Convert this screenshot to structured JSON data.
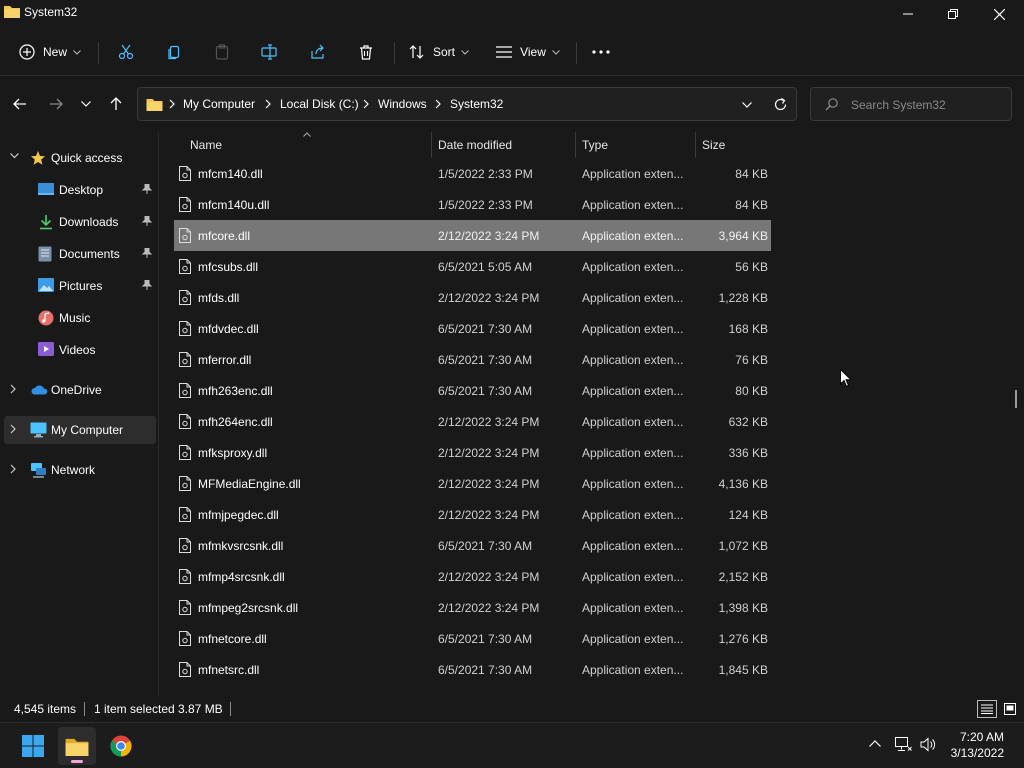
{
  "window": {
    "title": "System32"
  },
  "toolbar": {
    "new_label": "New",
    "sort_label": "Sort",
    "view_label": "View"
  },
  "breadcrumb": [
    "My Computer",
    "Local Disk (C:)",
    "Windows",
    "System32"
  ],
  "search": {
    "placeholder": "Search System32"
  },
  "sidebar": {
    "quick_access": "Quick access",
    "items": [
      {
        "label": "Desktop",
        "icon": "desktop-icon",
        "pinned": true
      },
      {
        "label": "Downloads",
        "icon": "downloads-icon",
        "pinned": true
      },
      {
        "label": "Documents",
        "icon": "documents-icon",
        "pinned": true
      },
      {
        "label": "Pictures",
        "icon": "pictures-icon",
        "pinned": true
      },
      {
        "label": "Music",
        "icon": "music-icon",
        "pinned": false
      },
      {
        "label": "Videos",
        "icon": "videos-icon",
        "pinned": false
      }
    ],
    "onedrive": "OneDrive",
    "my_computer": "My Computer",
    "network": "Network"
  },
  "columns": {
    "name": "Name",
    "date": "Date modified",
    "type": "Type",
    "size": "Size"
  },
  "files": [
    {
      "name": "mfcm140.dll",
      "date": "1/5/2022 2:33 PM",
      "type": "Application exten...",
      "size": "84 KB"
    },
    {
      "name": "mfcm140u.dll",
      "date": "1/5/2022 2:33 PM",
      "type": "Application exten...",
      "size": "84 KB"
    },
    {
      "name": "mfcore.dll",
      "date": "2/12/2022 3:24 PM",
      "type": "Application exten...",
      "size": "3,964 KB"
    },
    {
      "name": "mfcsubs.dll",
      "date": "6/5/2021 5:05 AM",
      "type": "Application exten...",
      "size": "56 KB"
    },
    {
      "name": "mfds.dll",
      "date": "2/12/2022 3:24 PM",
      "type": "Application exten...",
      "size": "1,228 KB"
    },
    {
      "name": "mfdvdec.dll",
      "date": "6/5/2021 7:30 AM",
      "type": "Application exten...",
      "size": "168 KB"
    },
    {
      "name": "mferror.dll",
      "date": "6/5/2021 7:30 AM",
      "type": "Application exten...",
      "size": "76 KB"
    },
    {
      "name": "mfh263enc.dll",
      "date": "6/5/2021 7:30 AM",
      "type": "Application exten...",
      "size": "80 KB"
    },
    {
      "name": "mfh264enc.dll",
      "date": "2/12/2022 3:24 PM",
      "type": "Application exten...",
      "size": "632 KB"
    },
    {
      "name": "mfksproxy.dll",
      "date": "2/12/2022 3:24 PM",
      "type": "Application exten...",
      "size": "336 KB"
    },
    {
      "name": "MFMediaEngine.dll",
      "date": "2/12/2022 3:24 PM",
      "type": "Application exten...",
      "size": "4,136 KB"
    },
    {
      "name": "mfmjpegdec.dll",
      "date": "2/12/2022 3:24 PM",
      "type": "Application exten...",
      "size": "124 KB"
    },
    {
      "name": "mfmkvsrcsnk.dll",
      "date": "6/5/2021 7:30 AM",
      "type": "Application exten...",
      "size": "1,072 KB"
    },
    {
      "name": "mfmp4srcsnk.dll",
      "date": "2/12/2022 3:24 PM",
      "type": "Application exten...",
      "size": "2,152 KB"
    },
    {
      "name": "mfmpeg2srcsnk.dll",
      "date": "2/12/2022 3:24 PM",
      "type": "Application exten...",
      "size": "1,398 KB"
    },
    {
      "name": "mfnetcore.dll",
      "date": "6/5/2021 7:30 AM",
      "type": "Application exten...",
      "size": "1,276 KB"
    },
    {
      "name": "mfnetsrc.dll",
      "date": "6/5/2021 7:30 AM",
      "type": "Application exten...",
      "size": "1,845 KB"
    }
  ],
  "selected_index": 2,
  "status": {
    "count": "4,545 items",
    "selected": "1 item selected",
    "size": "3.87 MB"
  },
  "taskbar": {
    "time": "7:20 AM",
    "date": "3/13/2022"
  },
  "colors": {
    "background": "#191919",
    "selected_row": "#777777",
    "folder": "#f2c94c",
    "accent": "#4cc2ff"
  }
}
